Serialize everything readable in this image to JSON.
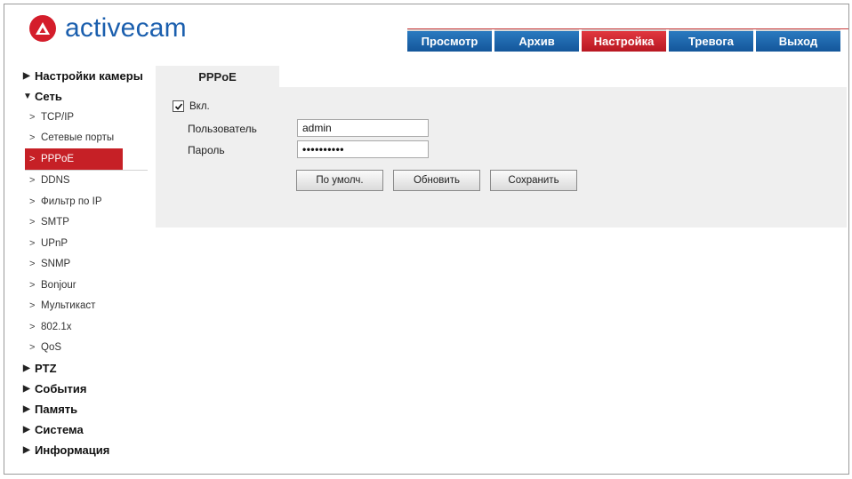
{
  "brand": {
    "name": "activecam",
    "icon": "activecam-logo-icon",
    "color": "#1b5fae",
    "accent": "#d41d2b"
  },
  "nav": [
    {
      "label": "Просмотр",
      "active": false
    },
    {
      "label": "Архив",
      "active": false
    },
    {
      "label": "Настройка",
      "active": true
    },
    {
      "label": "Тревога",
      "active": false
    },
    {
      "label": "Выход",
      "active": false
    }
  ],
  "sidebar": {
    "camera_settings": "Настройки камеры",
    "network": {
      "label": "Сеть",
      "items": [
        "TCP/IP",
        "Сетевые порты",
        "PPPoE",
        "DDNS",
        "Фильтр по IP",
        "SMTP",
        "UPnP",
        "SNMP",
        "Bonjour",
        "Мультикаст",
        "802.1x",
        "QoS"
      ],
      "active": "PPPoE"
    },
    "ptz": "PTZ",
    "events": "События",
    "storage": "Память",
    "system": "Система",
    "info": "Информация"
  },
  "content": {
    "tab_label": "PPPoE",
    "enable_label": "Вкл.",
    "enabled": true,
    "user_label": "Пользователь",
    "user_value": "admin",
    "password_label": "Пароль",
    "password_value": "••••••••••",
    "buttons": {
      "default": "По умолч.",
      "refresh": "Обновить",
      "save": "Сохранить"
    }
  }
}
